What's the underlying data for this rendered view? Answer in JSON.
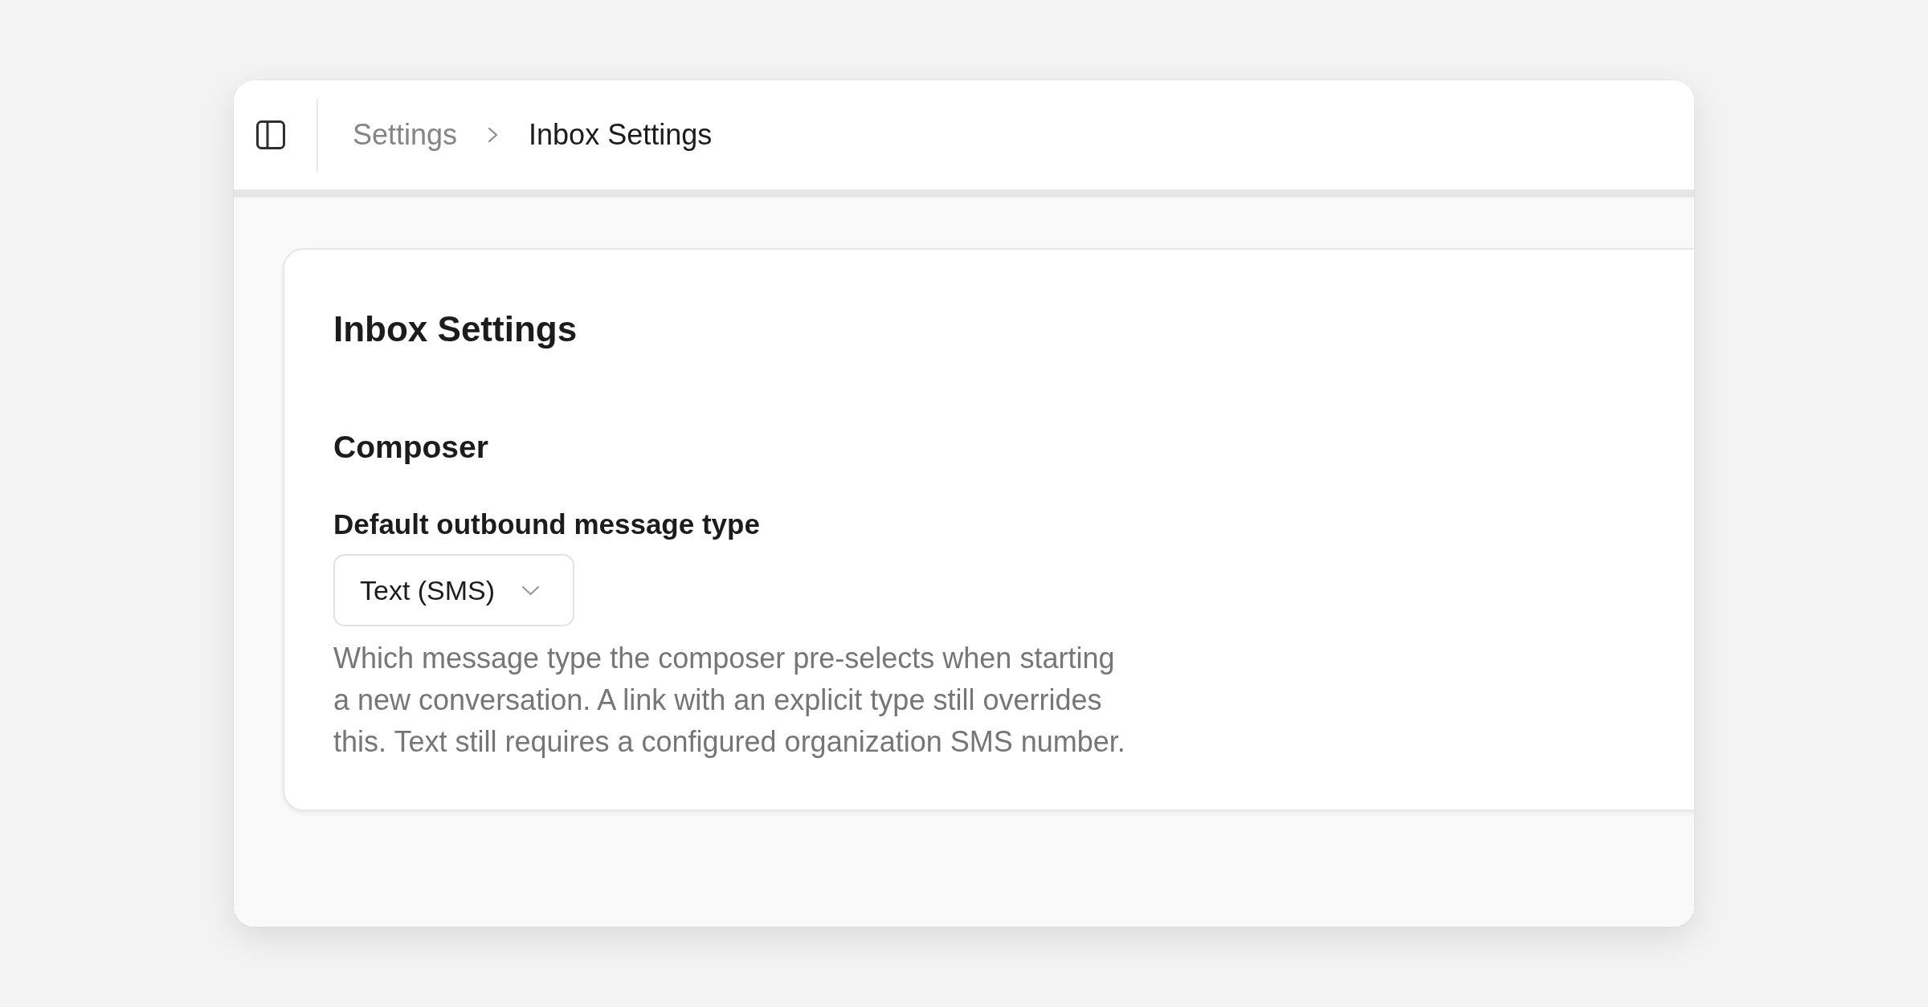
{
  "header": {
    "breadcrumbs": [
      {
        "label": "Settings",
        "current": false
      },
      {
        "label": "Inbox Settings",
        "current": true
      }
    ]
  },
  "page": {
    "title": "Inbox Settings",
    "sections": [
      {
        "title": "Composer",
        "fields": [
          {
            "kind": "select",
            "label": "Default outbound message type",
            "value": "Text (SMS)",
            "help": "Which message type the composer pre-selects when starting a new conversation. A link with an explicit type still overrides this. Text still requires a configured organization SMS number."
          }
        ]
      }
    ]
  }
}
